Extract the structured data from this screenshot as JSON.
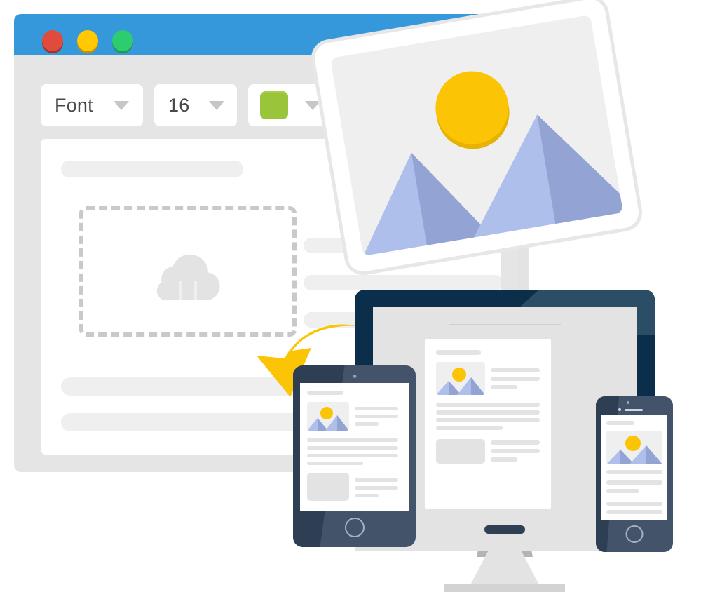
{
  "scene": {
    "title": "Drag and drop image upload to responsive devices illustration",
    "background": "#ffffff"
  },
  "editor_window": {
    "name": "image-editor-window",
    "titlebar_color": "#3498db",
    "chrome_color": "#e5e5e5",
    "canvas_color": "#ffffff",
    "traffic_lights": [
      {
        "name": "close-button",
        "color": "#e04b3c"
      },
      {
        "name": "minimize-button",
        "color": "#ffc800"
      },
      {
        "name": "maximize-button",
        "color": "#2ecc71"
      }
    ],
    "toolbar": {
      "font_label": "Font",
      "size_label": "16",
      "color_swatch": "#9ac43a",
      "caret_color": "#c6c6c6",
      "buttons": [
        "Font",
        "16",
        "color-swatch",
        ""
      ]
    },
    "dropzone": {
      "name": "upload-dropzone",
      "border_color": "#c9c9c9",
      "icon": "cloud-upload-icon",
      "icon_color": "#e3e3e3"
    },
    "arrow": {
      "name": "drop-here-arrow",
      "color": "#fbc404",
      "direction": "down-left"
    },
    "placeholders": {
      "heading_bar_color": "#efefef",
      "text_bar_color": "#efefef"
    }
  },
  "photo_card": {
    "name": "uploaded-photo-card",
    "frame_color": "#ffffff",
    "frame_border": "#e7e7e7",
    "image_bg": "#efefef",
    "rotation_deg": -9.5,
    "sun_color": "#fbc404",
    "sun_shadow": "#e8b300",
    "mountain_light": "#aebfec",
    "mountain_dark": "#93a4d4"
  },
  "devices": {
    "monitor": {
      "name": "desktop-monitor",
      "bezel_color": "#0b2e4a",
      "bezel_highlight": "#2b4e66",
      "screen_bg": "#e3e3e3",
      "chin_color": "#e3e3e3",
      "stand_color": "#e3e3e3",
      "base_color": "#d3d3d3",
      "logo_color": "#2f4055"
    },
    "tablet": {
      "name": "tablet-device",
      "body_color": "#42536a",
      "shadow_color": "#2e3e53",
      "screen_bg": "#ffffff",
      "home_button_color": "#a7b1bf"
    },
    "phone": {
      "name": "phone-device",
      "body_color": "#42536a",
      "shadow_color": "#2e3e53",
      "screen_bg": "#ffffff",
      "home_button_color": "#a7b1bf",
      "speaker_color": "#cfd6df"
    }
  },
  "mock_page": {
    "name": "responsive-article-mock",
    "title_bar_color": "#e3e3e3",
    "thumb_bg": "#efefef",
    "text_bar_color": "#e3e3e3",
    "box_color": "#e3e3e3",
    "sun_color": "#fbc404",
    "mountain_light": "#aebfec",
    "mountain_dark": "#93a4d4"
  }
}
